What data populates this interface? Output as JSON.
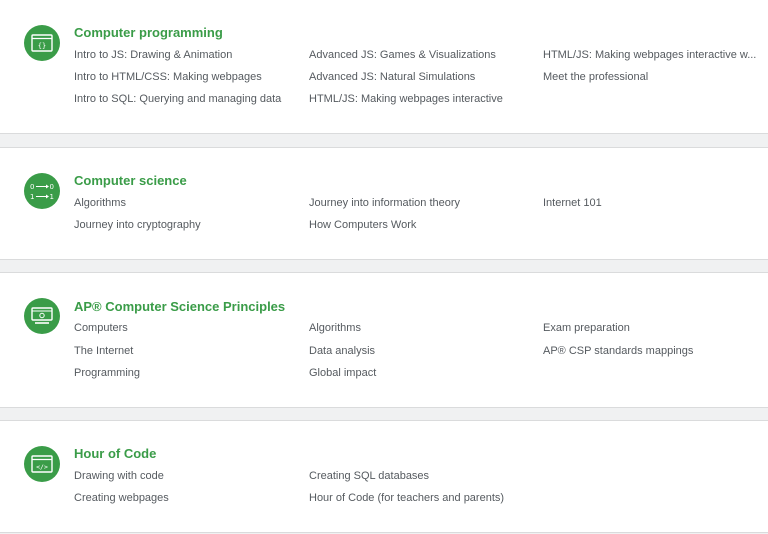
{
  "sections": [
    {
      "title": "Computer programming",
      "icon": "code-window-icon",
      "links": [
        [
          "Intro to JS: Drawing & Animation",
          "Intro to HTML/CSS: Making webpages",
          "Intro to SQL: Querying and managing data"
        ],
        [
          "Advanced JS: Games & Visualizations",
          "Advanced JS: Natural Simulations",
          "HTML/JS: Making webpages interactive"
        ],
        [
          "HTML/JS: Making webpages interactive w...",
          "Meet the professional"
        ]
      ]
    },
    {
      "title": "Computer science",
      "icon": "binary-arrows-icon",
      "links": [
        [
          "Algorithms",
          "Journey into cryptography"
        ],
        [
          "Journey into information theory",
          "How Computers Work"
        ],
        [
          "Internet 101"
        ]
      ]
    },
    {
      "title": "AP® Computer Science Principles",
      "icon": "monitor-icon",
      "links": [
        [
          "Computers",
          "The Internet",
          "Programming"
        ],
        [
          "Algorithms",
          "Data analysis",
          "Global impact"
        ],
        [
          "Exam preparation",
          "AP® CSP standards mappings"
        ]
      ]
    },
    {
      "title": "Hour of Code",
      "icon": "code-tag-window-icon",
      "links": [
        [
          "Drawing with code",
          "Creating webpages"
        ],
        [
          "Creating SQL databases",
          "Hour of Code (for teachers and parents)"
        ]
      ]
    }
  ],
  "colors": {
    "accent": "#3a9c48",
    "link": "#555a5f",
    "background": "#f0f1f2"
  }
}
